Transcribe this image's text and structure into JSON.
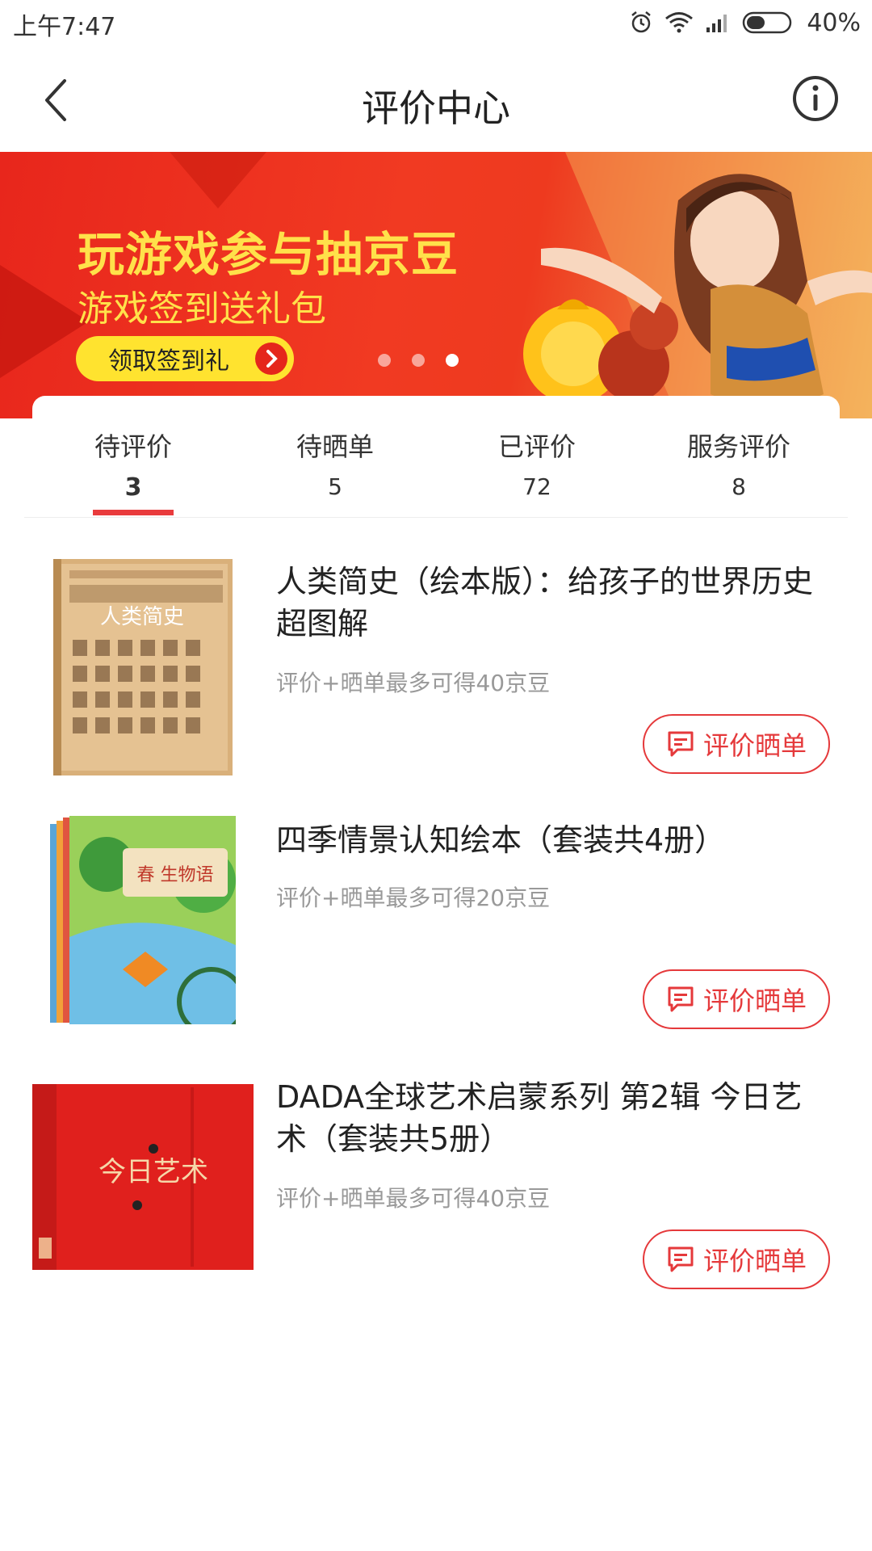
{
  "status_bar": {
    "time": "上午7:47",
    "battery": "40%",
    "icons": [
      "alarm-icon",
      "wifi-icon",
      "signal-icon",
      "battery-icon"
    ]
  },
  "nav": {
    "title": "评价中心",
    "back_icon": "chevron-left-icon",
    "info_icon": "info-icon"
  },
  "banner": {
    "title": "玩游戏参与抽京豆",
    "subtitle": "游戏签到送礼包",
    "button_label": "领取签到礼",
    "carousel": {
      "count": 3,
      "active_index": 2
    }
  },
  "tabs": [
    {
      "label": "待评价",
      "count": "3",
      "active": true
    },
    {
      "label": "待晒单",
      "count": "5",
      "active": false
    },
    {
      "label": "已评价",
      "count": "72",
      "active": false
    },
    {
      "label": "服务评价",
      "count": "8",
      "active": false
    }
  ],
  "products": [
    {
      "title": "人类简史（绘本版）：给孩子的世界历史超图解",
      "reward": "评价+晒单最多可得40京豆",
      "button_label": "评价晒单",
      "cover_text": "人类简史"
    },
    {
      "title": "四季情景认知绘本（套装共4册）",
      "reward": "评价+晒单最多可得20京豆",
      "button_label": "评价晒单",
      "cover_text": "春 生物语"
    },
    {
      "title": "DADA全球艺术启蒙系列 第2辑 今日艺术（套装共5册）",
      "reward": "评价+晒单最多可得40京豆",
      "button_label": "评价晒单",
      "cover_text": "今日艺术"
    }
  ],
  "colors": {
    "accent": "#e5393b",
    "banner_red": "#ee3a1f",
    "banner_yellow": "#ffe14a"
  }
}
